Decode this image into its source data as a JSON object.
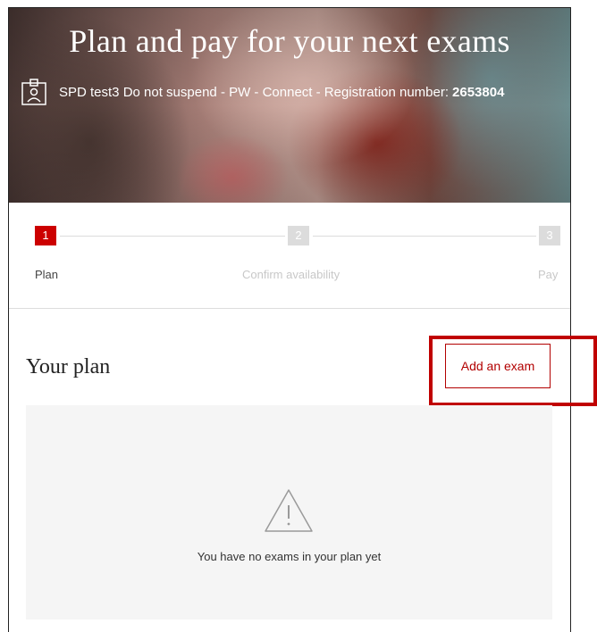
{
  "hero": {
    "title": "Plan and pay for your next exams",
    "user_line": "SPD test3 Do not suspend - PW - Connect - Registration number:",
    "registration_number": "2653804",
    "icon": "id-badge-icon"
  },
  "stepper": {
    "steps": [
      {
        "number": "1",
        "label": "Plan",
        "state": "active"
      },
      {
        "number": "2",
        "label": "Confirm availability",
        "state": "inactive"
      },
      {
        "number": "3",
        "label": "Pay",
        "state": "inactive"
      }
    ]
  },
  "plan": {
    "title": "Your plan",
    "add_button_label": "Add an exam",
    "empty_message": "You have no exams in your plan yet",
    "empty_icon": "warning-icon"
  },
  "colors": {
    "accent": "#cc0000",
    "step_inactive": "#dcdcdc",
    "highlight": "#c00000",
    "panel_bg": "#f5f5f5"
  }
}
